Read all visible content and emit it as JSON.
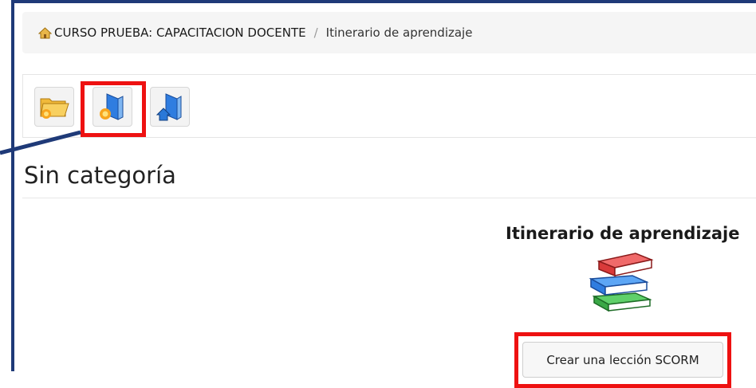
{
  "breadcrumb": {
    "home_icon": "home-icon",
    "course": "CURSO PRUEBA: CAPACITACION DOCENTE",
    "separator": "/",
    "current": "Itinerario de aprendizaje"
  },
  "toolbar": {
    "buttons": [
      {
        "icon": "new-folder-icon"
      },
      {
        "icon": "new-page-icon"
      },
      {
        "icon": "import-page-icon"
      }
    ]
  },
  "category": {
    "title": "Sin categoría"
  },
  "module": {
    "title": "Itinerario de aprendizaje",
    "icon": "books-icon",
    "create_button": "Crear una lección SCORM"
  },
  "colors": {
    "highlight": "#ee1111",
    "frame": "#1f3a78"
  }
}
